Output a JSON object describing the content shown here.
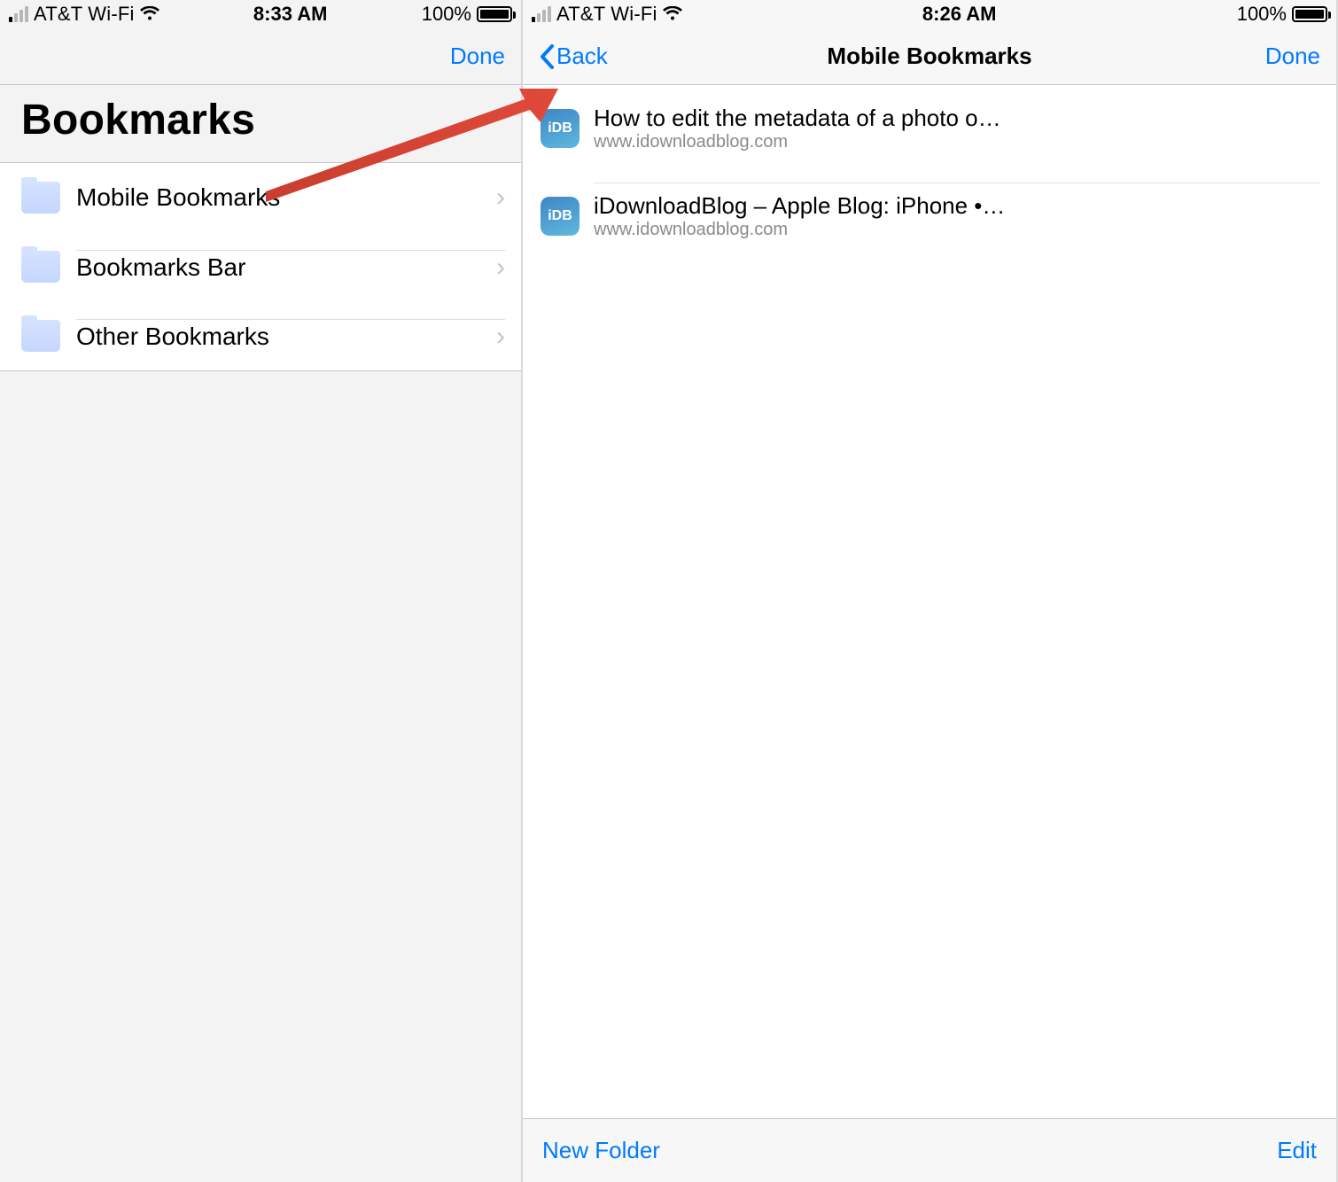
{
  "left": {
    "status": {
      "carrier": "AT&T Wi-Fi",
      "time": "8:33 AM",
      "battery": "100%"
    },
    "nav": {
      "done": "Done"
    },
    "title": "Bookmarks",
    "folders": [
      {
        "label": "Mobile Bookmarks"
      },
      {
        "label": "Bookmarks Bar"
      },
      {
        "label": "Other Bookmarks"
      }
    ]
  },
  "right": {
    "status": {
      "carrier": "AT&T Wi-Fi",
      "time": "8:26 AM",
      "battery": "100%"
    },
    "nav": {
      "back": "Back",
      "title": "Mobile Bookmarks",
      "done": "Done"
    },
    "bookmarks": [
      {
        "title": "How to edit the metadata of a photo o…",
        "url": "www.idownloadblog.com",
        "favname": "iDB"
      },
      {
        "title": "iDownloadBlog – Apple Blog: iPhone •…",
        "url": "www.idownloadblog.com",
        "favname": "iDB"
      }
    ],
    "toolbar": {
      "new_folder": "New Folder",
      "edit": "Edit"
    }
  }
}
